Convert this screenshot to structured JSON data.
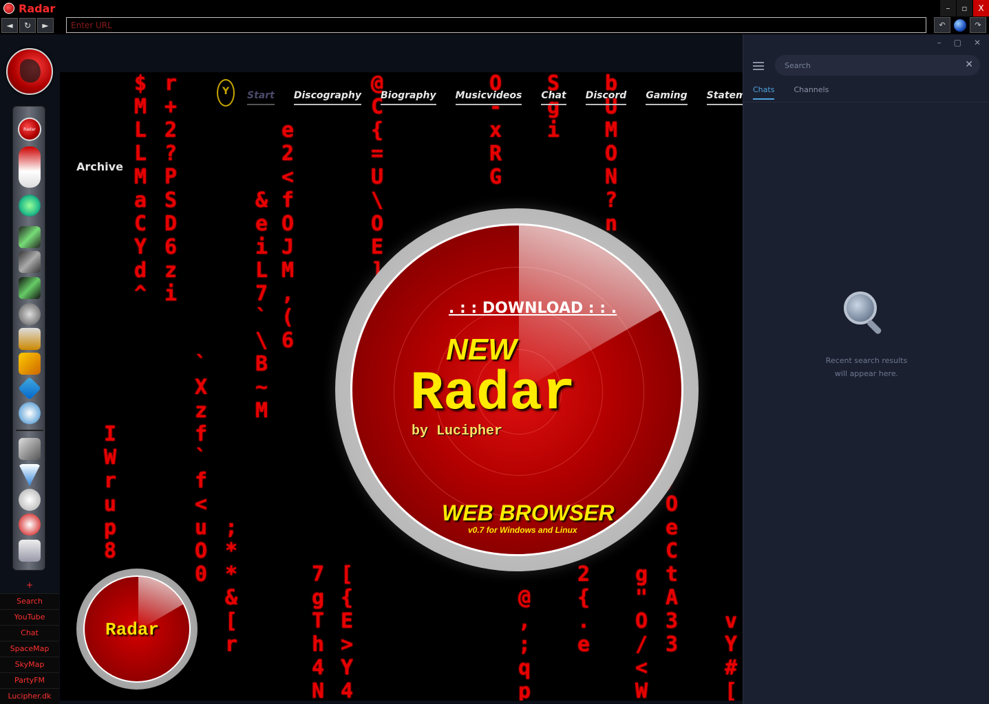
{
  "app": {
    "title": "Radar"
  },
  "window_controls": {
    "minimize": "–",
    "maximize": "▫",
    "close": "X"
  },
  "address_bar": {
    "placeholder": "Enter URL"
  },
  "sidebar": {
    "dock_radar_label": "Radar",
    "links": [
      "+",
      "Search",
      "YouTube",
      "Chat",
      "SpaceMap",
      "SkyMap",
      "PartyFM",
      "Lucipher.dk"
    ]
  },
  "page": {
    "archive": "Archive",
    "nav": [
      "Start",
      "Discography",
      "Biography",
      "Musicvideos",
      "Chat",
      "Discord",
      "Gaming",
      "Statements"
    ],
    "promo": {
      "download": ". : : DOWNLOAD : : .",
      "new": "NEW",
      "title": "Radar",
      "by": "by Lucipher",
      "subtitle": "WEB BROWSER",
      "version": "v0.7 for Windows and Linux"
    },
    "badge": "Radar"
  },
  "chat_panel": {
    "search_placeholder": "Search",
    "tabs": [
      "Chats",
      "Channels"
    ],
    "empty_line1": "Recent search results",
    "empty_line2": "will appear here."
  },
  "colors": {
    "accent_red": "#e60000",
    "tab_active": "#4fa3e0",
    "promo_yellow": "#ffea00"
  }
}
